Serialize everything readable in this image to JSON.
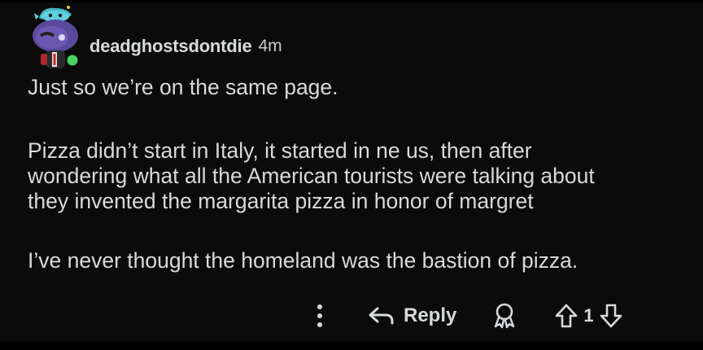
{
  "comment": {
    "username": "deadghostsdontdie",
    "timestamp": "4m",
    "paragraphs": [
      "Just so we’re on the same page.",
      "Pizza didn’t start in Italy, it started in ne us, then after\nwondering what all the American tourists were talking about\nthey invented the margarita pizza in honor of margret",
      "I’ve never thought the homeland was the bastion of pizza."
    ],
    "online": true
  },
  "actions": {
    "more_icon": "more-vertical-icon",
    "reply_label": "Reply",
    "reply_icon": "reply-arrow-icon",
    "award_icon": "award-icon",
    "upvote_icon": "upvote-arrow-icon",
    "downvote_icon": "downvote-arrow-icon",
    "vote_count": "1"
  },
  "colors": {
    "background": "#0b0b0b",
    "text": "#d7dadc",
    "online_indicator": "#46d160"
  }
}
